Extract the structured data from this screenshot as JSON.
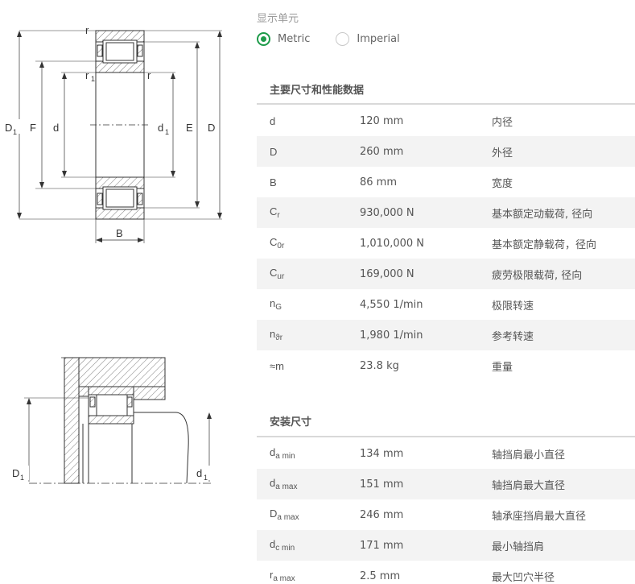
{
  "units": {
    "display_label": "显示单元",
    "metric_label": "Metric",
    "imperial_label": "Imperial",
    "selected": "Metric"
  },
  "accent_color": "#1e9b4a",
  "section_main": {
    "title": "主要尺寸和性能数据",
    "rows": [
      {
        "sym": "d",
        "sub": "",
        "value": "120 mm",
        "desc": "内径"
      },
      {
        "sym": "D",
        "sub": "",
        "value": "260 mm",
        "desc": "外径"
      },
      {
        "sym": "B",
        "sub": "",
        "value": "86 mm",
        "desc": "宽度"
      },
      {
        "sym": "C",
        "sub": "r",
        "value": "930,000 N",
        "desc": "基本额定动载荷, 径向"
      },
      {
        "sym": "C",
        "sub": "0r",
        "value": "1,010,000 N",
        "desc": "基本额定静载荷，径向"
      },
      {
        "sym": "C",
        "sub": "ur",
        "value": "169,000 N",
        "desc": "疲劳极限载荷, 径向"
      },
      {
        "sym": "n",
        "sub": "G",
        "value": "4,550 1/min",
        "desc": "极限转速"
      },
      {
        "sym": "n",
        "sub": "ϑr",
        "value": "1,980 1/min",
        "desc": "参考转速"
      },
      {
        "sym": "≈m",
        "sub": "",
        "value": "23.8 kg",
        "desc": "重量"
      }
    ]
  },
  "section_mount": {
    "title": "安装尺寸",
    "rows": [
      {
        "sym": "d",
        "sub": "a min",
        "value": "134 mm",
        "desc": "轴挡肩最小直径"
      },
      {
        "sym": "d",
        "sub": "a max",
        "value": "151 mm",
        "desc": "轴挡肩最大直径"
      },
      {
        "sym": "D",
        "sub": "a max",
        "value": "246 mm",
        "desc": "轴承座挡肩最大直径"
      },
      {
        "sym": "d",
        "sub": "c min",
        "value": "171 mm",
        "desc": "最小轴挡肩"
      },
      {
        "sym": "r",
        "sub": "a max",
        "value": "2.5 mm",
        "desc": "最大凹穴半径"
      }
    ]
  },
  "drawing1": {
    "labels": {
      "D1": "D",
      "D1_sub": "1",
      "F": "F",
      "d": "d",
      "d1": "d",
      "d1_sub": "1",
      "E": "E",
      "D": "D",
      "B": "B",
      "r_top": "r",
      "r1": "r",
      "r1_sub": "1",
      "r_right": "r"
    }
  },
  "drawing2": {
    "labels": {
      "D1": "D",
      "D1_sub": "1",
      "d1": "d",
      "d1_sub": "1"
    }
  }
}
